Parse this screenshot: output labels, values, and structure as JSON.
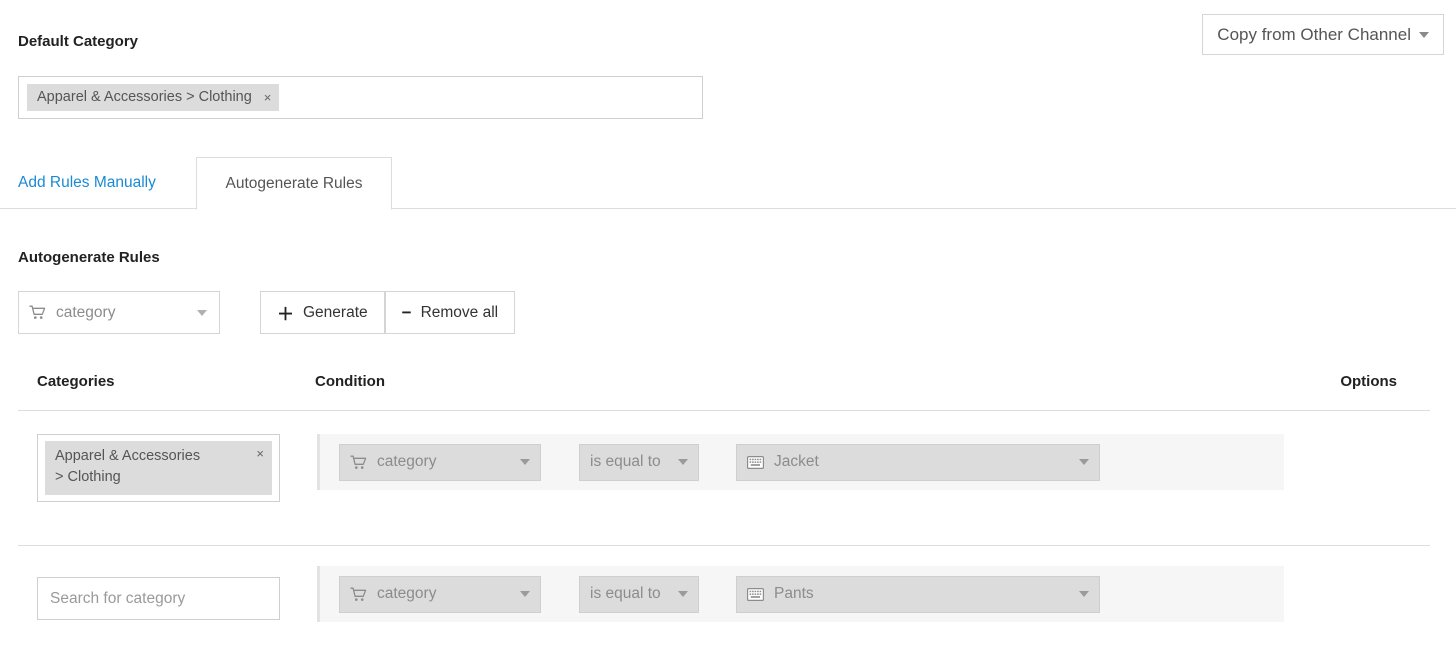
{
  "header": {
    "copy_button_label": "Copy from Other Channel"
  },
  "default_category": {
    "title": "Default Category",
    "tag": "Apparel & Accessories > Clothing",
    "remove_symbol": "×"
  },
  "tabs": [
    {
      "label": "Add Rules Manually",
      "active": false
    },
    {
      "label": "Autogenerate Rules",
      "active": true
    }
  ],
  "autogenerate": {
    "title": "Autogenerate Rules",
    "attribute_select": {
      "value": "category",
      "icon": "cart-icon"
    },
    "generate_button": {
      "sign": "＋",
      "label": "Generate"
    },
    "remove_all_button": {
      "sign": "−",
      "label": "Remove all"
    }
  },
  "table": {
    "columns": {
      "categories": "Categories",
      "condition": "Condition",
      "options": "Options"
    },
    "rows": [
      {
        "category_tag_line1": "Apparel & Accessories",
        "category_tag_line2": "> Clothing",
        "remove_symbol": "×",
        "attribute": "category",
        "operator": "is equal to",
        "value": "Jacket"
      },
      {
        "category_placeholder": "Search for category",
        "category_value": "",
        "attribute": "category",
        "operator": "is equal to",
        "value": "Pants"
      }
    ]
  },
  "colors": {
    "link": "#1a8ad4",
    "tag_bg": "#dcdcdc",
    "condition_bg": "#f6f6f6",
    "border": "#dddddd"
  }
}
